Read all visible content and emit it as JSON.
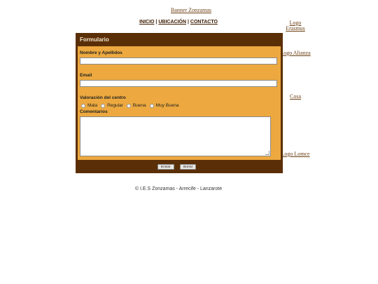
{
  "banner": {
    "label": "Banner Zonzamas"
  },
  "nav": {
    "items": [
      {
        "label": "INICIO"
      },
      {
        "label": "UBICACIÓN"
      },
      {
        "label": "CONTACTO"
      }
    ],
    "separator": "|"
  },
  "sidebar": {
    "links": [
      {
        "label": "Logo Erasmus"
      },
      {
        "label": "Logo Alianza"
      },
      {
        "label": "Cosa"
      },
      {
        "label": "Logo Lomce"
      }
    ]
  },
  "form": {
    "title": "Formulario",
    "name_label": "Nombre y Apellidos",
    "name_value": "",
    "email_label": "Email",
    "email_value": "",
    "rating_label": "Valoración del centro",
    "rating_options": [
      "Mala",
      "Regular",
      "Buena",
      "Muy Buena"
    ],
    "comments_label": "Comentarios",
    "comments_value": "",
    "submit_label": "Enviar",
    "reset_label": "Borrar"
  },
  "footer": {
    "text": "© I.E.S Zonzamas - Arrecife - Lanzarote"
  },
  "colors": {
    "header_brown": "#5a2f08",
    "form_orange": "#eda93f",
    "link_brown": "#6b3f12"
  }
}
